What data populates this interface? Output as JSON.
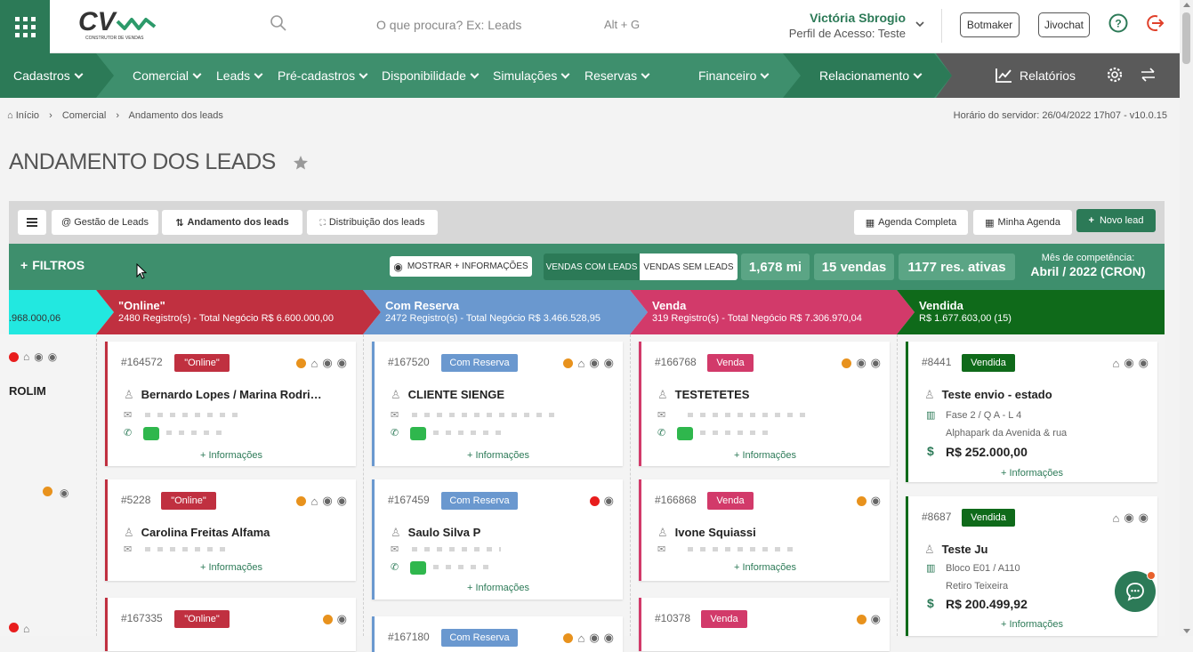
{
  "header": {
    "search_placeholder": "O que procura? Ex: Leads",
    "search_hint": "Alt + G",
    "user_name": "Victória Sbrogio",
    "user_profile": "Perfil de Acesso: Teste",
    "botmaker": "Botmaker",
    "jivochat": "Jivochat"
  },
  "nav": {
    "cadastros": "Cadastros",
    "comercial": "Comercial",
    "leads": "Leads",
    "pre_cadastros": "Pré-cadastros",
    "disponibilidade": "Disponibilidade",
    "simulacoes": "Simulações",
    "reservas": "Reservas",
    "financeiro": "Financeiro",
    "relacionamento": "Relacionamento",
    "relatorios": "Relatórios"
  },
  "breadcrumb": {
    "inicio": "Início",
    "comercial": "Comercial",
    "current": "Andamento dos leads"
  },
  "server_time": "Horário do servidor: 26/04/2022 17h07 - v10.0.15",
  "page_title": "ANDAMENTO DOS LEADS",
  "toolbar": {
    "gestao": "@ Gestão de Leads",
    "andamento": "Andamento dos leads",
    "distribuicao": "Distribuição dos leads",
    "agenda_completa": "Agenda Completa",
    "minha_agenda": "Minha Agenda",
    "novo_lead": "Novo lead"
  },
  "filters": {
    "label": "FILTROS",
    "mostrar": "MOSTRAR + INFORMAÇÕES",
    "vendas_com": "VENDAS COM LEADS",
    "vendas_sem": "VENDAS SEM LEADS",
    "stat1": "1,678 mi",
    "stat2": "15 vendas",
    "stat3": "1177 res. ativas",
    "comp_label": "Mês de competência:",
    "comp_value": "Abril / 2022 (CRON)"
  },
  "columns": {
    "prev": {
      "subtitle": ".968.000,06",
      "card_name": "ROLIM"
    },
    "online": {
      "title": "\"Online\"",
      "subtitle": "2480 Registro(s) - Total Negócio R$ 6.600.000,00",
      "color": "#c03040"
    },
    "com_reserva": {
      "title": "Com Reserva",
      "subtitle": "2472 Registro(s) - Total Negócio R$ 3.466.528,95",
      "color": "#6a98cf"
    },
    "venda": {
      "title": "Venda",
      "subtitle": "319 Registro(s) - Total Negócio R$ 7.306.970,04",
      "color": "#d23a6a"
    },
    "vendida": {
      "title": "Vendida",
      "subtitle": "R$ 1.677.603,00 (15)",
      "color": "#0f6a1a"
    }
  },
  "cards": {
    "online": [
      {
        "id": "#164572",
        "badge": "\"Online\"",
        "name": "Bernardo Lopes / Marina Rodri…"
      },
      {
        "id": "#5228",
        "badge": "\"Online\"",
        "name": "Carolina Freitas Alfama"
      },
      {
        "id": "#167335",
        "badge": "\"Online\""
      }
    ],
    "com_reserva": [
      {
        "id": "#167520",
        "badge": "Com Reserva",
        "name": "CLIENTE SIENGE"
      },
      {
        "id": "#167459",
        "badge": "Com Reserva",
        "name": "Saulo Silva P"
      },
      {
        "id": "#167180",
        "badge": "Com Reserva"
      }
    ],
    "venda": [
      {
        "id": "#166768",
        "badge": "Venda",
        "name": "TESTETETES"
      },
      {
        "id": "#166868",
        "badge": "Venda",
        "name": "Ivone Squiassi"
      },
      {
        "id": "#10378",
        "badge": "Venda"
      }
    ],
    "vendida": [
      {
        "id": "#8441",
        "badge": "Vendida",
        "name": "Teste envio - estado",
        "unit": "Fase 2 / Q A - L 4",
        "project": "Alphapark da Avenida & rua",
        "value": "R$ 252.000,00"
      },
      {
        "id": "#8687",
        "badge": "Vendida",
        "name": "Teste Ju",
        "unit": "Bloco E01 / A110",
        "project": "Retiro Teixeira",
        "value": "R$ 200.499,92"
      }
    ]
  },
  "more_info": "+ Informações"
}
